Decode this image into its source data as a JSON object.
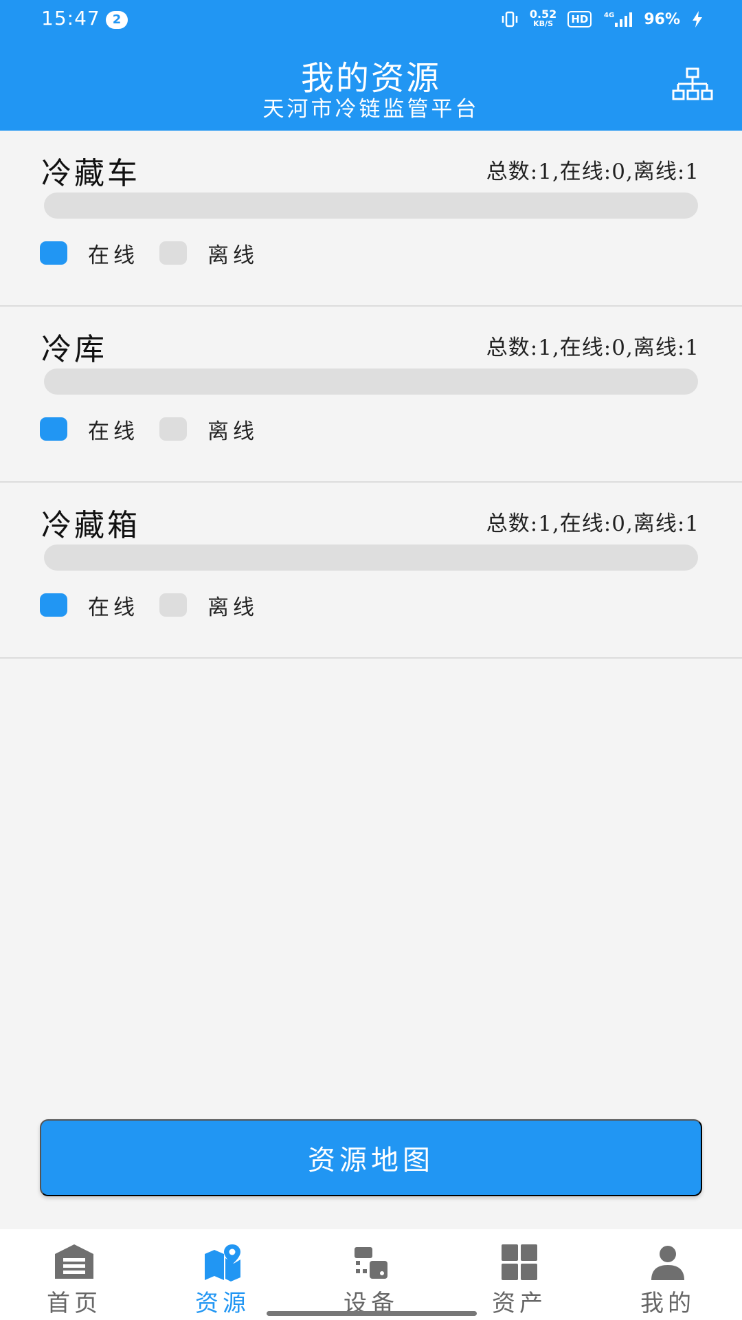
{
  "status_bar": {
    "time": "15:47",
    "notification_count": "2",
    "net_speed_value": "0.52",
    "net_speed_unit": "KB/S",
    "hd": "HD",
    "network": "4G",
    "battery": "96%"
  },
  "header": {
    "title": "我的资源",
    "subtitle": "天河市冷链监管平台",
    "org_icon": "org-chart-icon"
  },
  "sections": [
    {
      "name": "冷藏车",
      "stats": "总数:1,在线:0,离线:1",
      "online_fraction": 0
    },
    {
      "name": "冷库",
      "stats": "总数:1,在线:0,离线:1",
      "online_fraction": 0
    },
    {
      "name": "冷藏箱",
      "stats": "总数:1,在线:0,离线:1",
      "online_fraction": 0
    }
  ],
  "legend": {
    "online": "在线",
    "offline": "离线"
  },
  "map_button": "资源地图",
  "nav": [
    {
      "label": "首页",
      "icon": "home-icon",
      "active": false
    },
    {
      "label": "资源",
      "icon": "map-pin-icon",
      "active": true
    },
    {
      "label": "设备",
      "icon": "devices-icon",
      "active": false
    },
    {
      "label": "资产",
      "icon": "grid-icon",
      "active": false
    },
    {
      "label": "我的",
      "icon": "user-icon",
      "active": false
    }
  ],
  "colors": {
    "primary": "#2196f3",
    "track": "#dedede",
    "offline_swatch": "#dddddd"
  }
}
